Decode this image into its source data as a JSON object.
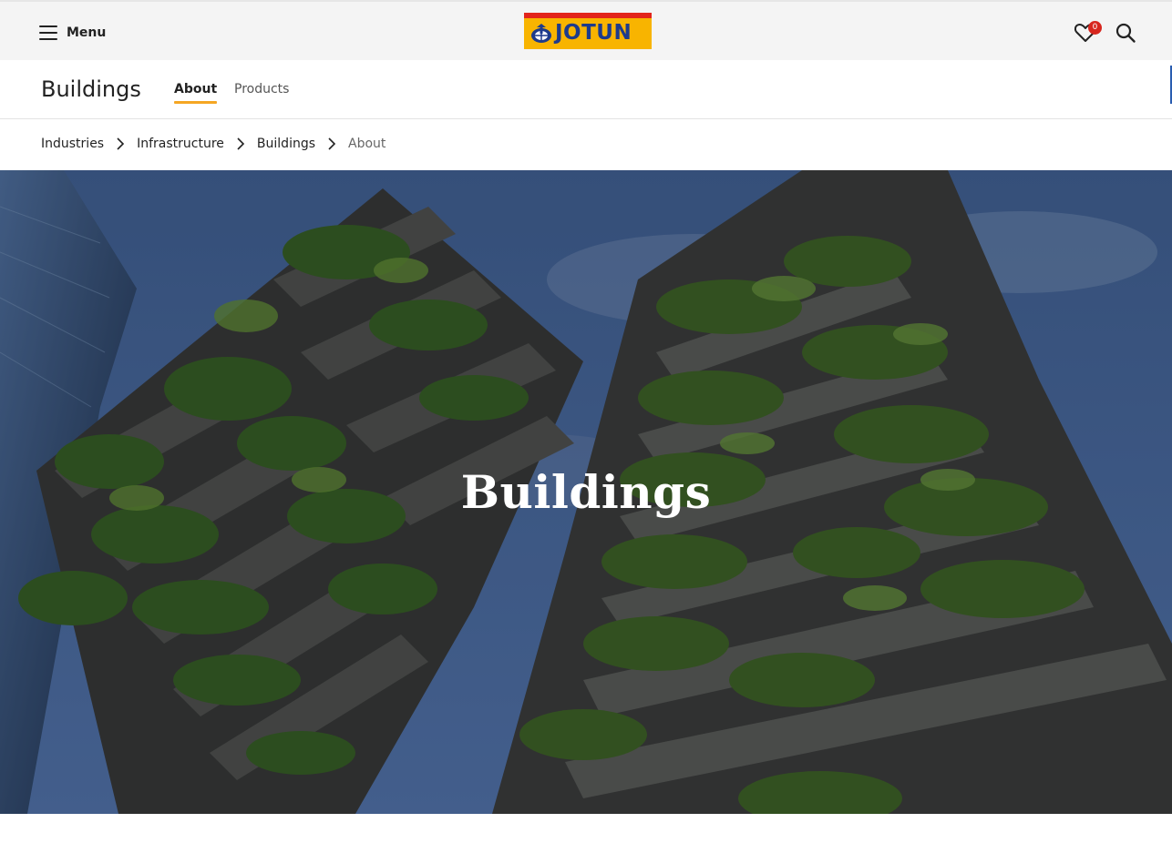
{
  "header": {
    "menu_label": "Menu",
    "logo_text": "JOTUN",
    "favourites_count": "0",
    "icons": [
      "hamburger-icon",
      "heart-icon",
      "search-icon"
    ],
    "colors": {
      "logo_red": "#e2241b",
      "logo_yellow": "#f8b400",
      "logo_blue": "#1d3b8c",
      "badge": "#d7261e"
    }
  },
  "subnav": {
    "title": "Buildings",
    "tabs": [
      {
        "label": "About",
        "active": true
      },
      {
        "label": "Products",
        "active": false
      }
    ],
    "accent_color": "#f5a623"
  },
  "breadcrumb": {
    "items": [
      {
        "label": "Industries"
      },
      {
        "label": "Infrastructure"
      },
      {
        "label": "Buildings"
      },
      {
        "label": "About",
        "current": true
      }
    ]
  },
  "hero": {
    "title": "Buildings"
  }
}
